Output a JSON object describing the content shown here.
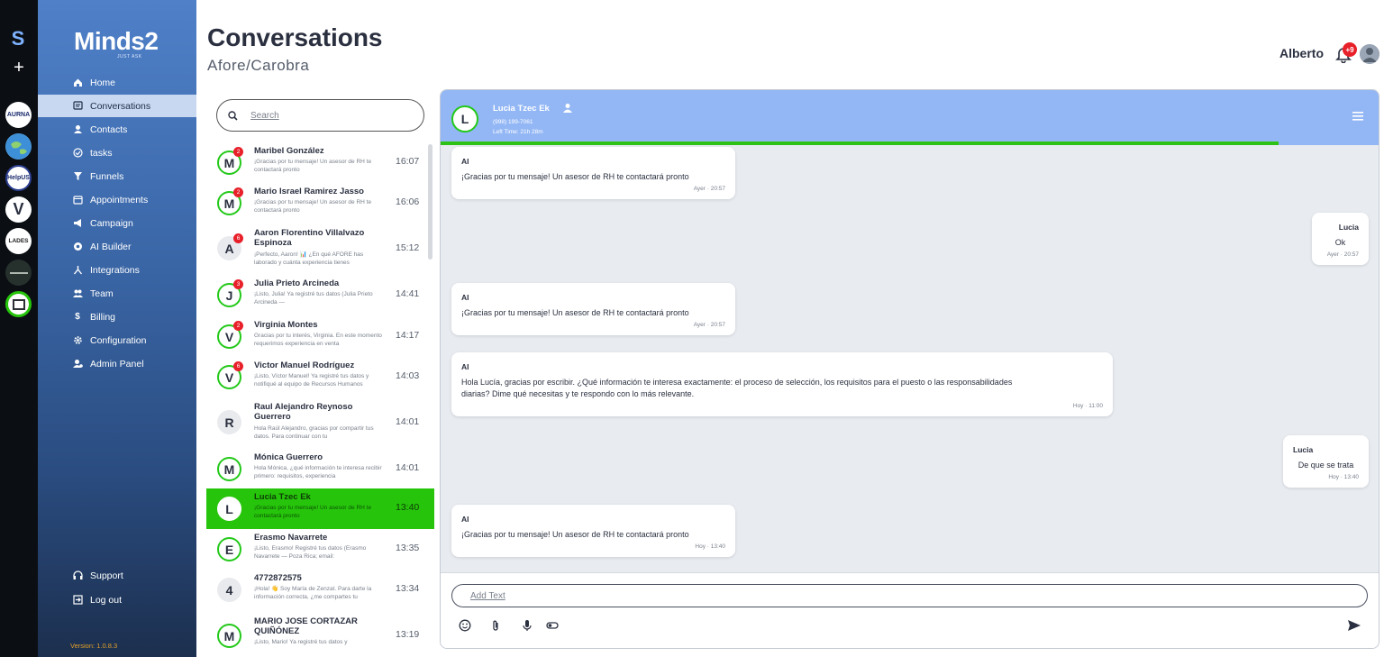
{
  "rail": {
    "logo": "S",
    "plus": "+",
    "workspaces": [
      "AURNA",
      "",
      "HelpUS",
      "V",
      "LADES",
      "",
      ""
    ]
  },
  "sidebar": {
    "brand": "Minds2",
    "brand_sub": "JUST ASK",
    "items": [
      {
        "label": "Home",
        "icon": "home-icon"
      },
      {
        "label": "Conversations",
        "icon": "chat-icon"
      },
      {
        "label": "Contacts",
        "icon": "person-icon"
      },
      {
        "label": "tasks",
        "icon": "check-circle-icon"
      },
      {
        "label": "Funnels",
        "icon": "funnel-icon"
      },
      {
        "label": "Appointments",
        "icon": "calendar-icon"
      },
      {
        "label": "Campaign",
        "icon": "megaphone-icon"
      },
      {
        "label": "AI Builder",
        "icon": "ai-icon"
      },
      {
        "label": "Integrations",
        "icon": "integration-icon"
      },
      {
        "label": "Team",
        "icon": "team-icon"
      },
      {
        "label": "Billing",
        "icon": "dollar-icon"
      },
      {
        "label": "Configuration",
        "icon": "gear-icon"
      },
      {
        "label": "Admin Panel",
        "icon": "admin-icon"
      }
    ],
    "bottom": [
      {
        "label": "Support",
        "icon": "support-icon"
      },
      {
        "label": "Log out",
        "icon": "logout-icon"
      }
    ],
    "version": "Version: 1.0.8.3"
  },
  "header": {
    "title": "Conversations",
    "subtitle": "Afore/Carobra",
    "user": "Alberto",
    "notif_count": "+9"
  },
  "search": {
    "placeholder": "Search"
  },
  "conversations": [
    {
      "initial": "M",
      "name": "Maribel González",
      "preview": "¡Gracias por tu mensaje! Un asesor de RH te contactará pronto",
      "time": "16:07",
      "unread": "2"
    },
    {
      "initial": "M",
      "name": "Mario Israel Ramirez Jasso",
      "preview": "¡Gracias por tu mensaje! Un asesor de RH te contactará pronto",
      "time": "16:06",
      "unread": "2"
    },
    {
      "initial": "A",
      "name": "Aaron Florentino Villalvazo Espinoza",
      "preview": "¡Perfecto, Aaron! 📊 ¿En qué AFORE has laborado y cuánta experiencia tienes",
      "time": "15:12",
      "unread": "6"
    },
    {
      "initial": "J",
      "name": "Julia Prieto Arcineda",
      "preview": "¡Listo, Julia! Ya registré tus datos (Julia Prieto Arcineda —",
      "time": "14:41",
      "unread": "3"
    },
    {
      "initial": "V",
      "name": "Virginia Montes",
      "preview": "Gracias por tu interés, Virginia. En este momento requerimos experiencia en venta",
      "time": "14:17",
      "unread": "2"
    },
    {
      "initial": "V",
      "name": "Victor Manuel Rodríguez",
      "preview": "¡Listo, Víctor Manuel! Ya registré tus datos y notifiqué al equipo de Recursos Humanos",
      "time": "14:03",
      "unread": "6"
    },
    {
      "initial": "R",
      "name": "Raul Alejandro Reynoso Guerrero",
      "preview": "Hola Raúl Alejandro, gracias por compartir tus datos. Para continuar con tu",
      "time": "14:01",
      "unread": ""
    },
    {
      "initial": "M",
      "name": "Mónica Guerrero",
      "preview": "Hola Mónica, ¿qué información te interesa recibir primero: requisitos, experiencia",
      "time": "14:01",
      "unread": ""
    },
    {
      "initial": "L",
      "name": "Lucia Tzec Ek",
      "preview": "¡Gracias por tu mensaje! Un asesor de RH te contactará pronto",
      "time": "13:40",
      "unread": ""
    },
    {
      "initial": "E",
      "name": "Erasmo Navarrete",
      "preview": "¡Listo, Erasmo! Registré tus datos (Erasmo Navarrete — Poza Rica; email:",
      "time": "13:35",
      "unread": ""
    },
    {
      "initial": "4",
      "name": "4772872575",
      "preview": "¡Hola! 👋 Soy María de Zenzat. Para darte la información correcta, ¿me compartes tu",
      "time": "13:34",
      "unread": ""
    },
    {
      "initial": "M",
      "name": "MARIO JOSE CORTAZAR QUIÑÓNEZ",
      "preview": "¡Listo, Mario! Ya registré tus datos y",
      "time": "13:19",
      "unread": ""
    }
  ],
  "chat": {
    "initial": "L",
    "name": "Lucia Tzec Ek",
    "phone": "(998) 199-7061",
    "left_time": "Left Time: 21h 28m",
    "progress": 0.893,
    "messages": [
      {
        "side": "left",
        "sender": "AI",
        "text": "¡Gracias por tu mensaje! Un asesor de RH te contactará pronto",
        "time": "Ayer · 20:57"
      },
      {
        "side": "right",
        "sender": "Lucia",
        "text": "Ok",
        "time": "Ayer · 20:57"
      },
      {
        "side": "left",
        "sender": "AI",
        "text": "¡Gracias por tu mensaje! Un asesor de RH te contactará pronto",
        "time": "Ayer · 20:57"
      },
      {
        "side": "left",
        "sender": "AI",
        "text": "Hola Lucía, gracias por escribir. ¿Qué información te interesa exactamente: el proceso de selección, los requisitos para el puesto o las responsabilidades diarias? Dime qué necesitas y te respondo con lo más relevante.",
        "time": "Hoy · 11:00"
      },
      {
        "side": "right",
        "sender": "Lucia",
        "text": "De que se trata",
        "time": "Hoy · 13:40"
      },
      {
        "side": "left",
        "sender": "AI",
        "text": "¡Gracias por tu mensaje! Un asesor de RH te contactará pronto",
        "time": "Hoy · 13:40"
      }
    ],
    "composer_placeholder": "Add Text"
  },
  "colors": {
    "accent_green": "#26c50b",
    "chat_header": "#93b7f5",
    "badge_red": "#e8202a"
  }
}
